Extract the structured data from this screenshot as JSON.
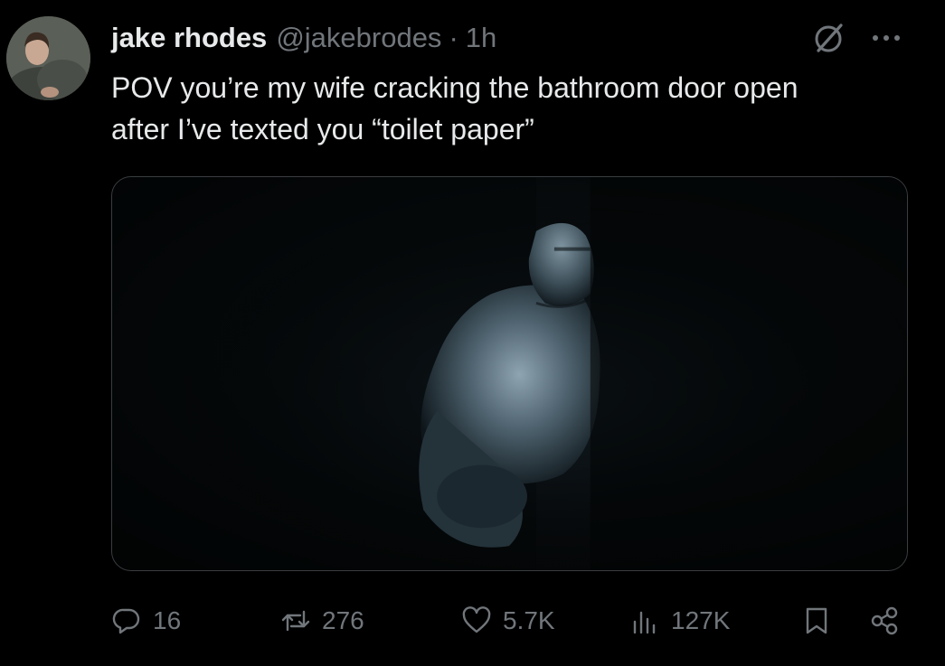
{
  "tweet": {
    "author_name": "jake rhodes",
    "handle": "@jakebrodes",
    "separator": "·",
    "time": "1h",
    "text_line1": "POV you’re my wife cracking the bathroom door open",
    "text_line2": "after I’ve texted you “toilet paper”"
  },
  "actions": {
    "replies": "16",
    "reposts": "276",
    "likes": "5.7K",
    "views": "127K"
  },
  "icons": {
    "grok": "grok-icon",
    "more": "more-icon",
    "reply": "reply-icon",
    "repost": "repost-icon",
    "like": "heart-icon",
    "views": "views-icon",
    "bookmark": "bookmark-icon",
    "share": "share-icon"
  },
  "colors": {
    "background": "#000000",
    "text": "#e7e9ea",
    "secondary": "#71767b",
    "media_border": "#3a3d40"
  }
}
